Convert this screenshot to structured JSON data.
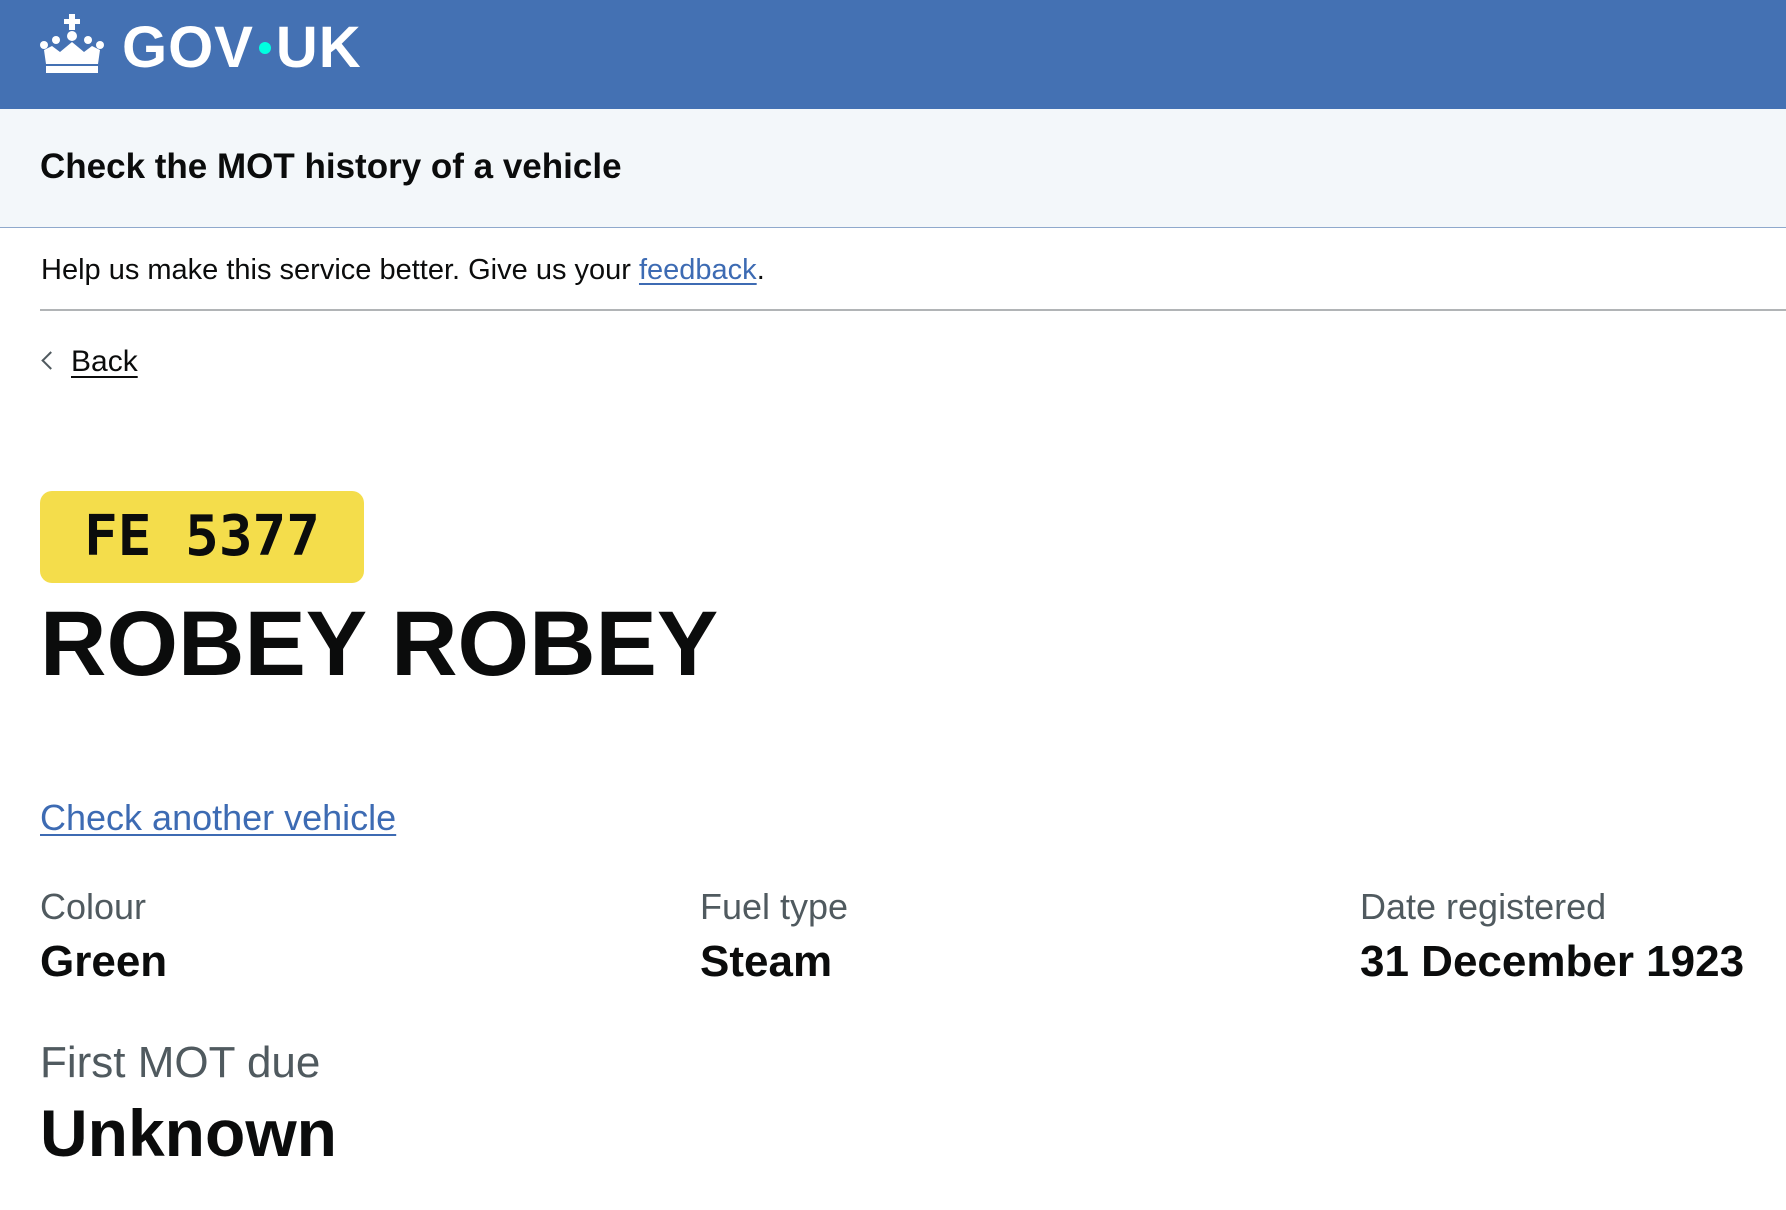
{
  "header": {
    "logo_icon": "crown-icon",
    "wordmark_left": "GOV",
    "wordmark_right": "UK",
    "background_color": "#4471b3",
    "dot_color": "#00ffe0"
  },
  "service": {
    "name": "Check the MOT history of a vehicle"
  },
  "feedback": {
    "text_before": "Help us make this service better. Give us your ",
    "link_text": "feedback",
    "text_after": "."
  },
  "navigation": {
    "back_icon": "chevron-left-icon",
    "back_label": "Back"
  },
  "vehicle": {
    "registration": "FE 5377",
    "plate_color": "#f4dd4b",
    "make_model": "ROBEY ROBEY",
    "check_another_label": "Check another vehicle",
    "details": {
      "colour": {
        "label": "Colour",
        "value": "Green"
      },
      "fuel_type": {
        "label": "Fuel type",
        "value": "Steam"
      },
      "date_registered": {
        "label": "Date registered",
        "value": "31 December 1923"
      },
      "first_mot_due": {
        "label": "First MOT due",
        "value": "Unknown"
      }
    }
  },
  "colors": {
    "link": "#3d6bb3",
    "text": "#0b0c0c",
    "secondary_text": "#505a5f"
  }
}
